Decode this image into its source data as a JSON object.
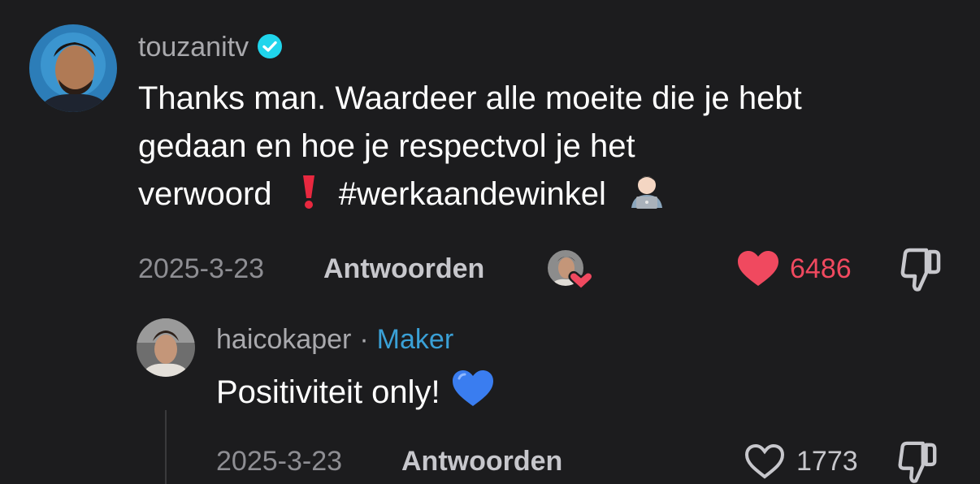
{
  "comment": {
    "username": "touzanitv",
    "verified": true,
    "text_line1": "Thanks man. Waardeer alle moeite die je hebt",
    "text_line2": "gedaan en hoe je respectvol je het",
    "text_line3_start": "verwoord",
    "hashtag": "#werkaandewinkel",
    "date": "2025-3-23",
    "reply_label": "Antwoorden",
    "like_count": "6486",
    "liked": true,
    "icons": [
      "red-exclamation-emoji",
      "man-technologist-emoji",
      "creator-liked-avatar",
      "heart-filled-icon",
      "thumbs-down-icon"
    ]
  },
  "reply": {
    "username": "haicokaper",
    "separator": "·",
    "role_badge": "Maker",
    "text": "Positiviteit only!",
    "date": "2025-3-23",
    "reply_label": "Antwoorden",
    "like_count": "1773",
    "liked": false,
    "icons": [
      "blue-heart-emoji",
      "heart-outline-icon",
      "thumbs-down-icon"
    ]
  },
  "colors": {
    "background": "#1c1c1e",
    "like_red": "#f0495f",
    "maker_blue": "#3aa0d6",
    "verified_blue": "#20d5ec"
  }
}
